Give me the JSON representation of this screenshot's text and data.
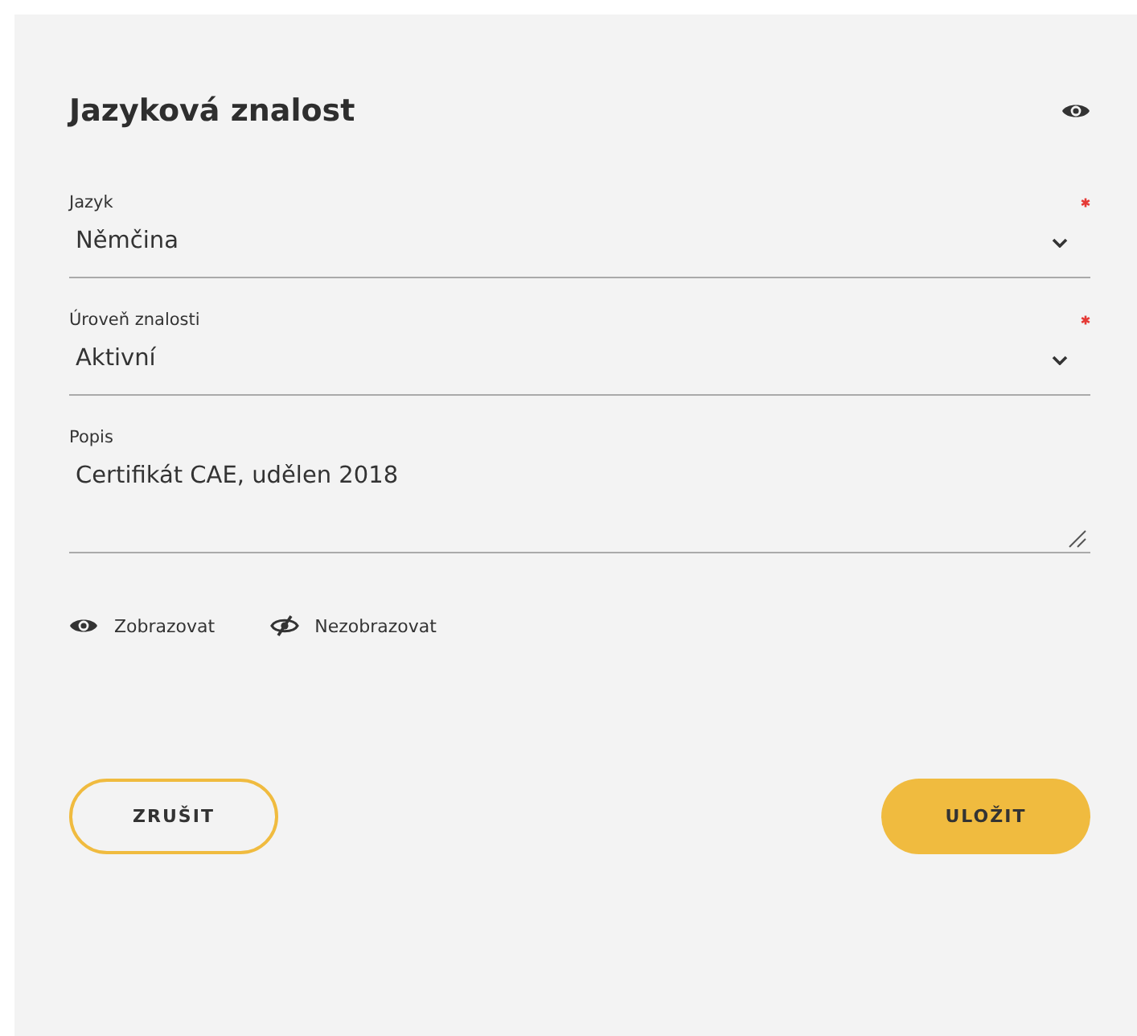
{
  "title": "Jazyková znalost",
  "fields": [
    {
      "kind": "select",
      "label": "Jazyk",
      "required": true,
      "value": "Němčina"
    },
    {
      "kind": "select",
      "label": "Úroveň znalosti",
      "required": true,
      "value": "Aktivní"
    },
    {
      "kind": "textarea",
      "label": "Popis",
      "required": false,
      "value": "Certifikát CAE, udělen 2018"
    }
  ],
  "visibility_options": [
    {
      "kind": "show",
      "label": "Zobrazovat"
    },
    {
      "kind": "hide",
      "label": "Nezobrazovat"
    }
  ],
  "buttons": [
    {
      "kind": "secondary",
      "label": "ZRUŠIT"
    },
    {
      "kind": "primary",
      "label": "ULOŽIT"
    }
  ]
}
